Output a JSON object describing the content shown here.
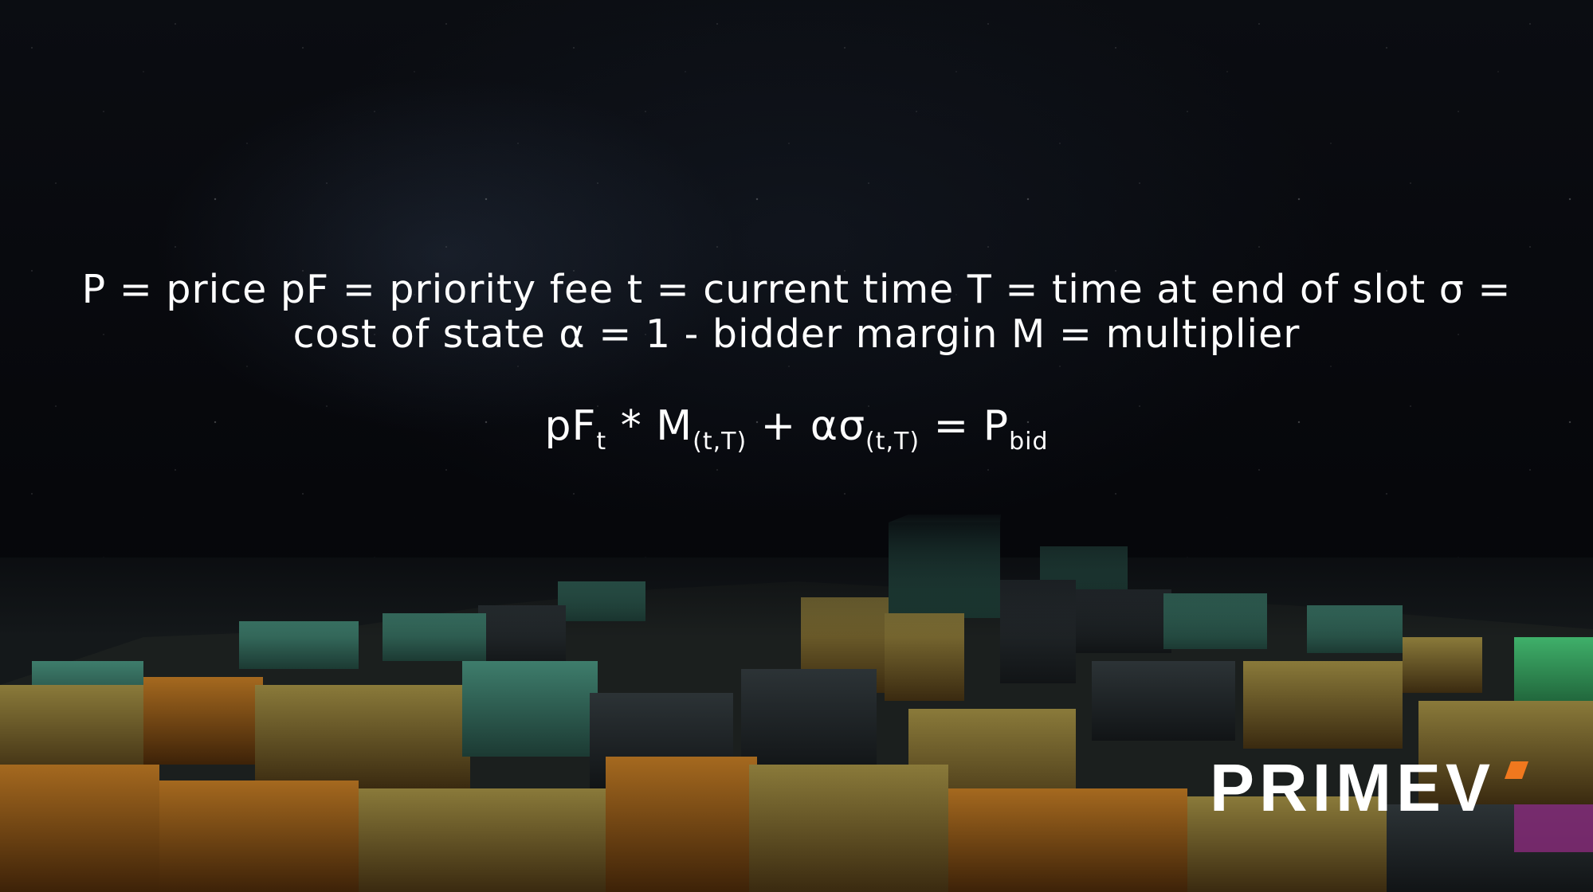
{
  "definitions": {
    "line1": "P = price pF = priority fee t = current time T = time at end of slot σ =",
    "line2": "cost of state α = 1 - bidder margin M = multiplier"
  },
  "equation": {
    "pf": "pF",
    "pf_sub": "t",
    "times": " * ",
    "m": "M",
    "m_sub": "(t,T)",
    "plus": " + ",
    "alpha_sigma": "ασ",
    "alpha_sigma_sub": "(t,T)",
    "equals": " = ",
    "p": "P",
    "p_sub": "bid"
  },
  "logo": {
    "text": "PRIMEV",
    "accent_color": "#f0781e"
  }
}
